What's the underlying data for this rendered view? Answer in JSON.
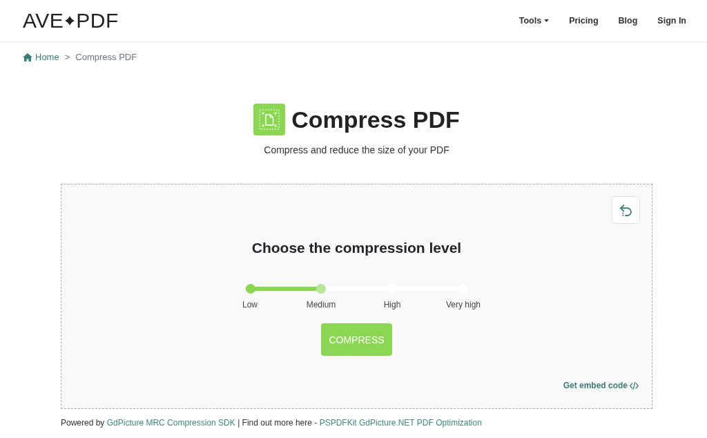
{
  "header": {
    "logo": {
      "left": "AVE",
      "right": "PDF"
    },
    "nav": [
      {
        "label": "Tools",
        "kind": "dropdown"
      },
      {
        "label": "Pricing",
        "kind": "link"
      },
      {
        "label": "Blog",
        "kind": "link"
      },
      {
        "label": "Sign In",
        "kind": "link"
      }
    ]
  },
  "breadcrumb": {
    "separator": ">",
    "items": [
      {
        "label": "Home",
        "kind": "home"
      },
      {
        "label": "Compress PDF",
        "kind": "current"
      }
    ]
  },
  "page": {
    "title": "Compress PDF",
    "subtitle": "Compress and reduce the size of your PDF"
  },
  "tool": {
    "heading": "Choose the compression level",
    "compression": {
      "level": 0.333,
      "steps": [
        {
          "label": "Low",
          "selected": false
        },
        {
          "label": "Medium",
          "selected": true
        },
        {
          "label": "High",
          "selected": false
        },
        {
          "label": "Very high",
          "selected": false
        }
      ]
    },
    "button": "COMPRESS",
    "embed_link": "Get embed code"
  },
  "footer": {
    "parts": [
      {
        "kind": "text",
        "text": "Powered by"
      },
      {
        "kind": "link",
        "text": "GdPicture MRC Compression SDK"
      },
      {
        "kind": "text",
        "text": "| Find out more here -"
      },
      {
        "kind": "link",
        "text": "PSPDFKit GdPicture.NET PDF Optimization"
      }
    ]
  }
}
